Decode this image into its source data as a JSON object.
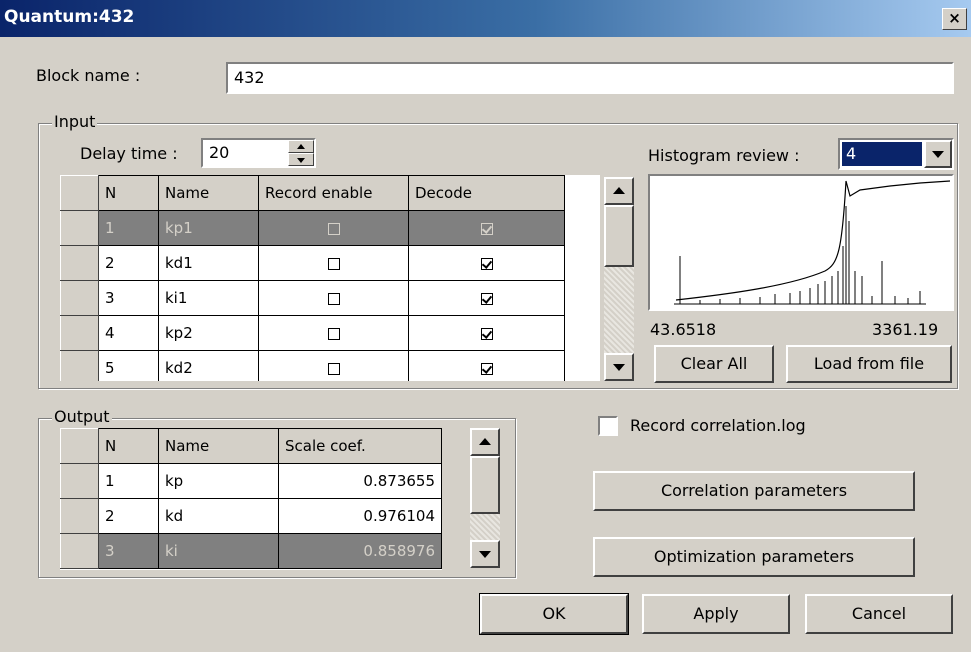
{
  "window": {
    "title": "Quantum:432",
    "close_glyph": "×",
    "close_icon": "close-icon"
  },
  "block_name": {
    "label": "Block name :",
    "value": "432"
  },
  "input": {
    "title": "Input",
    "delay_label": "Delay time :",
    "delay_value": "20",
    "columns": [
      "N",
      "Name",
      "Record enable",
      "Decode"
    ],
    "rows": [
      {
        "n": "1",
        "name": "kp1",
        "record": false,
        "decode": true,
        "selected": true
      },
      {
        "n": "2",
        "name": "kd1",
        "record": false,
        "decode": true,
        "selected": false
      },
      {
        "n": "3",
        "name": "ki1",
        "record": false,
        "decode": true,
        "selected": false
      },
      {
        "n": "4",
        "name": "kp2",
        "record": false,
        "decode": true,
        "selected": false
      },
      {
        "n": "5",
        "name": "kd2",
        "record": false,
        "decode": true,
        "selected": false
      }
    ]
  },
  "histogram": {
    "label": "Histogram review :",
    "selected": "4",
    "min_label": "43.6518",
    "max_label": "3361.19",
    "clear_label": "Clear All",
    "load_label": "Load from file"
  },
  "output": {
    "title": "Output",
    "columns": [
      "N",
      "Name",
      "Scale coef."
    ],
    "rows": [
      {
        "n": "1",
        "name": "kp",
        "scale": "0.873655",
        "selected": false
      },
      {
        "n": "2",
        "name": "kd",
        "scale": "0.976104",
        "selected": false
      },
      {
        "n": "3",
        "name": "ki",
        "scale": "0.858976",
        "selected": true
      }
    ]
  },
  "record_correlation": {
    "label": "Record correlation.log",
    "checked": false
  },
  "buttons": {
    "correlation": "Correlation parameters",
    "optimization": "Optimization parameters",
    "ok": "OK",
    "apply": "Apply",
    "cancel": "Cancel"
  },
  "colors": {
    "title_start": "#0a246a",
    "title_end": "#a6caf0",
    "face": "#d4d0c8",
    "selection": "#0a246a",
    "selected_row": "#808080"
  }
}
